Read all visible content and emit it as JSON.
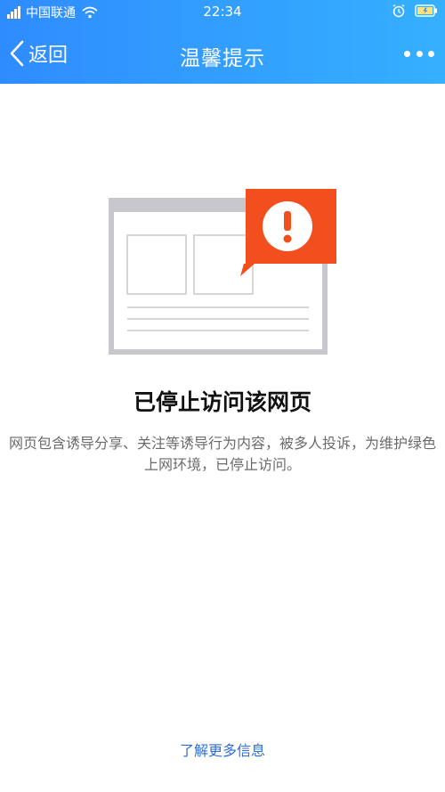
{
  "status_bar": {
    "carrier": "中国联通",
    "time": "22:34"
  },
  "nav": {
    "back_label": "返回",
    "title": "温馨提示"
  },
  "content": {
    "headline": "已停止访问该网页",
    "description": "网页包含诱导分享、关注等诱导行为内容，被多人投诉，为维护绿色上网环境，已停止访问。",
    "learn_more": "了解更多信息"
  },
  "colors": {
    "header_start": "#2f8cff",
    "header_end": "#35b0ff",
    "alert": "#f24e1e",
    "link": "#2f6fd8",
    "browser_frame": "#c8c8cc"
  }
}
